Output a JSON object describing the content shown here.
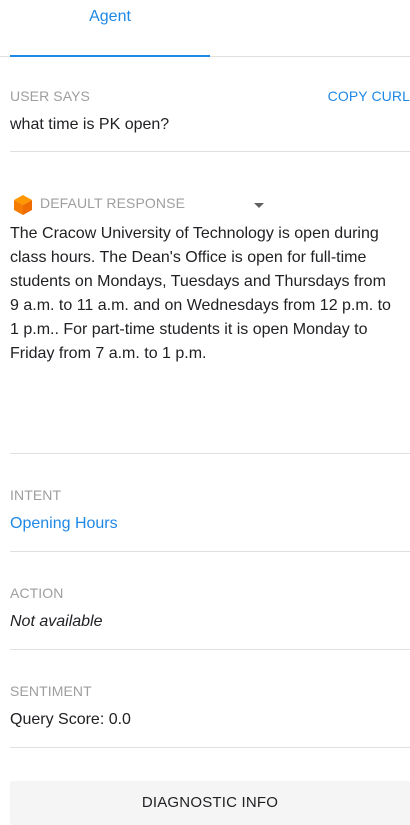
{
  "tabs": {
    "agent_label": "Agent"
  },
  "user_says": {
    "label": "USER SAYS",
    "copy_curl_label": "COPY CURL",
    "query": "what time is PK open?"
  },
  "response": {
    "label": "DEFAULT RESPONSE",
    "icon": "orange-cube-icon",
    "icon_color": "#ff6d00",
    "text": "The Cracow University of Technology is open during class hours. The Dean's Office is open for full-time students on Mondays, Tuesdays and Thursdays from 9 a.m. to 11 a.m. and on Wednesdays from 12 p.m. to 1 p.m.. For part-time students it is open Monday to Friday from 7 a.m. to 1 p.m."
  },
  "intent": {
    "label": "INTENT",
    "value": "Opening Hours"
  },
  "action": {
    "label": "ACTION",
    "value": "Not available"
  },
  "sentiment": {
    "label": "SENTIMENT",
    "value": "Query Score: 0.0"
  },
  "diagnostic": {
    "label": "DIAGNOSTIC INFO"
  },
  "colors": {
    "accent": "#1e88e5",
    "label_gray": "#9e9e9e",
    "divider": "#e0e0e0",
    "button_bg": "#f5f5f5"
  }
}
